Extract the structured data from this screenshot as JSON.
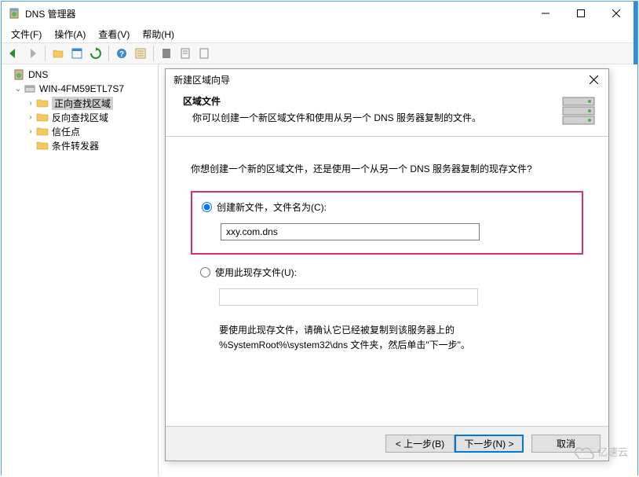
{
  "window": {
    "title": "DNS 管理器"
  },
  "menu": {
    "file": "文件(F)",
    "action": "操作(A)",
    "view": "查看(V)",
    "help": "帮助(H)"
  },
  "tree": {
    "root": "DNS",
    "server": "WIN-4FM59ETL7S7",
    "items": [
      "正向查找区域",
      "反向查找区域",
      "信任点",
      "条件转发器"
    ]
  },
  "wizard": {
    "title": "新建区域向导",
    "header_title": "区域文件",
    "header_sub": "你可以创建一个新区域文件和使用从另一个 DNS 服务器复制的文件。",
    "question": "你想创建一个新的区域文件，还是使用一个从另一个 DNS 服务器复制的现存文件?",
    "opt_create": "创建新文件，文件名为(C):",
    "filename": "xxy.com.dns",
    "opt_existing": "使用此现存文件(U):",
    "note_line1": "要使用此现存文件，请确认它已经被复制到该服务器上的",
    "note_line2": "%SystemRoot%\\system32\\dns 文件夹，然后单击\"下一步\"。",
    "btn_back": "< 上一步(B)",
    "btn_next": "下一步(N) >",
    "btn_cancel": "取消"
  },
  "watermark": "亿速云"
}
